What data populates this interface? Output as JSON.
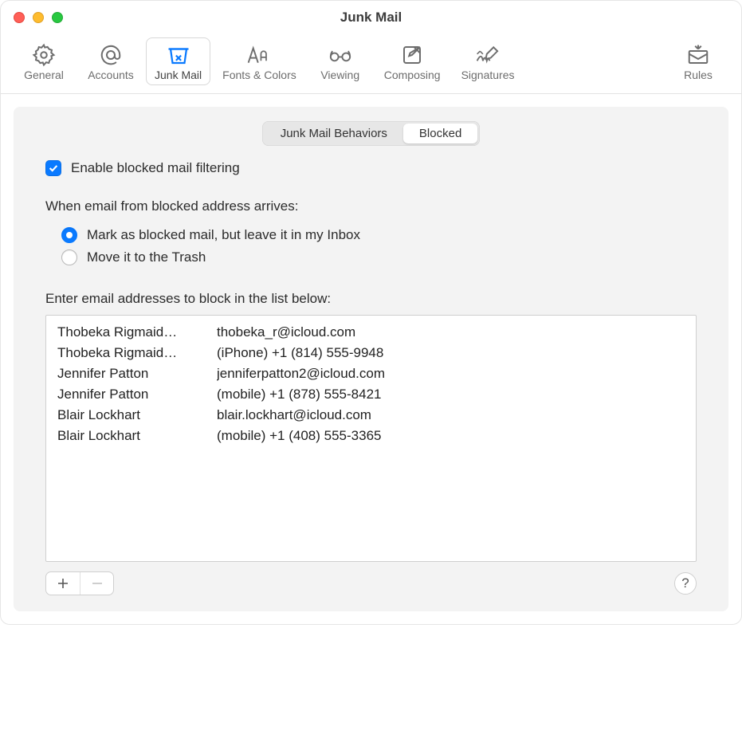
{
  "window": {
    "title": "Junk Mail"
  },
  "toolbar": {
    "items": [
      {
        "label": "General",
        "name": "toolbar-item-general",
        "icon": "gear-icon"
      },
      {
        "label": "Accounts",
        "name": "toolbar-item-accounts",
        "icon": "at-icon"
      },
      {
        "label": "Junk Mail",
        "name": "toolbar-item-junkmail",
        "icon": "junk-icon",
        "active": true
      },
      {
        "label": "Fonts & Colors",
        "name": "toolbar-item-fonts",
        "icon": "fonts-icon"
      },
      {
        "label": "Viewing",
        "name": "toolbar-item-viewing",
        "icon": "glasses-icon"
      },
      {
        "label": "Composing",
        "name": "toolbar-item-composing",
        "icon": "compose-icon"
      },
      {
        "label": "Signatures",
        "name": "toolbar-item-signatures",
        "icon": "signature-icon"
      },
      {
        "label": "Rules",
        "name": "toolbar-item-rules",
        "icon": "rules-icon"
      }
    ]
  },
  "tabs": {
    "behaviors": "Junk Mail Behaviors",
    "blocked": "Blocked",
    "selected": "blocked"
  },
  "enable_checkbox": {
    "checked": true,
    "label": "Enable blocked mail filtering"
  },
  "arrival": {
    "heading": "When email from blocked address arrives:",
    "options": {
      "mark": "Mark as blocked mail, but leave it in my Inbox",
      "trash": "Move it to the Trash"
    },
    "selected": "mark"
  },
  "list": {
    "heading": "Enter email addresses to block in the list below:",
    "rows": [
      {
        "name": "Thobeka Rigmaid…",
        "value": "thobeka_r@icloud.com"
      },
      {
        "name": "Thobeka Rigmaid…",
        "value": "(iPhone) +1 (814) 555-9948"
      },
      {
        "name": "Jennifer Patton",
        "value": "jenniferpatton2@icloud.com"
      },
      {
        "name": "Jennifer Patton",
        "value": "(mobile) +1 (878) 555-8421"
      },
      {
        "name": "Blair Lockhart",
        "value": "blair.lockhart@icloud.com"
      },
      {
        "name": "Blair Lockhart",
        "value": "(mobile) +1 (408) 555-3365"
      }
    ]
  },
  "footer": {
    "add_label": "+",
    "remove_label": "−",
    "help_label": "?"
  }
}
